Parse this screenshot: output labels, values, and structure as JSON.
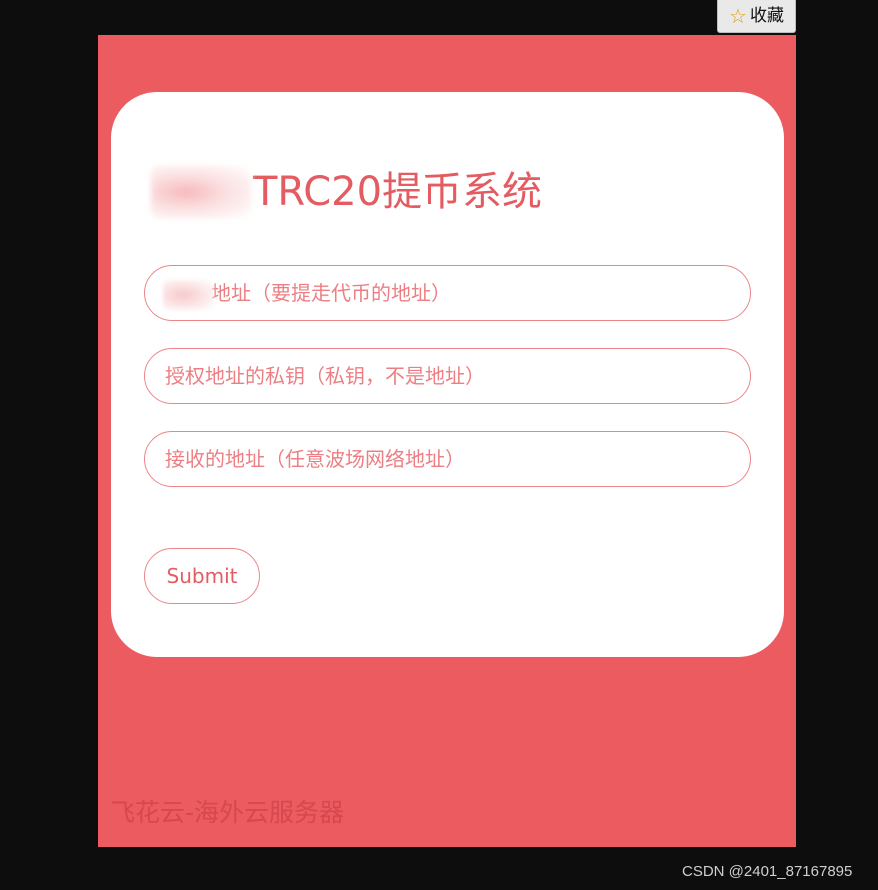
{
  "favorite": {
    "icon": "star-outline-icon",
    "label": "收藏",
    "star_color": "#e5a00d"
  },
  "card": {
    "title": "TRC20提币系统",
    "address_field": {
      "placeholder": "地址（要提走代币的地址）"
    },
    "private_key_field": {
      "placeholder": "授权地址的私钥（私钥，不是地址）"
    },
    "receive_field": {
      "placeholder": "接收的地址（任意波场网络地址）"
    },
    "submit_label": "Submit"
  },
  "footer": {
    "text": "飞花云-海外云服务器"
  },
  "watermark": {
    "text": "CSDN @2401_87167895"
  },
  "colors": {
    "background": "#ec5b60",
    "accent": "#e35c62",
    "card": "#ffffff"
  }
}
